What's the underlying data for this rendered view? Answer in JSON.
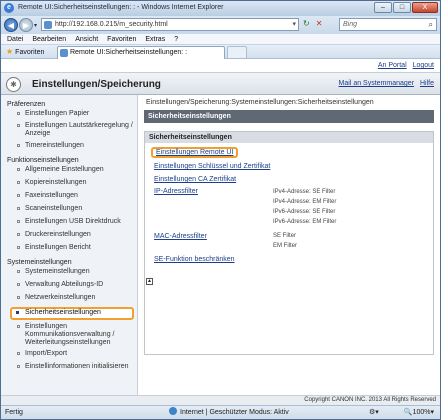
{
  "window": {
    "title": "Remote UI:Sicherheitseinstellungen: :  - Windows Internet Explorer",
    "minimize": "–",
    "maximize": "□",
    "close": "X"
  },
  "address": {
    "url": "http://192.168.0.215/m_security.html",
    "search_placeholder": "Bing",
    "back": "◀",
    "forward": "▶"
  },
  "menu": [
    "Datei",
    "Bearbeiten",
    "Ansicht",
    "Favoriten",
    "Extras",
    "?"
  ],
  "favorites": {
    "label": "Favoriten",
    "tab_title": "Remote UI:Sicherheitseinstellungen: :"
  },
  "portal": {
    "links": [
      "An Portal",
      "Logout"
    ]
  },
  "header": {
    "title": "Einstellungen/Speicherung",
    "links": [
      "Mail an Systemmanager",
      "Hilfe"
    ]
  },
  "sidebar": {
    "sections": [
      {
        "title": "Präferenzen",
        "items": [
          {
            "label": "Einstellungen Papier"
          },
          {
            "label": "Einstellungen Lautstärkeregelung / Anzeige"
          },
          {
            "label": "Timereinstellungen"
          }
        ]
      },
      {
        "title": "Funktionseinstellungen",
        "items": [
          {
            "label": "Allgemeine Einstellungen"
          },
          {
            "label": "Kopiereinstellungen"
          },
          {
            "label": "Faxeinstellungen"
          },
          {
            "label": "Scaneinstellungen"
          },
          {
            "label": "Einstellungen USB Direktdruck"
          },
          {
            "label": "Druckereinstellungen"
          },
          {
            "label": "Einstellungen Bericht"
          }
        ]
      },
      {
        "title": "Systemeinstellungen",
        "items": [
          {
            "label": "Systemeinstellungen"
          },
          {
            "label": "Verwaltung Abteilungs-ID"
          },
          {
            "label": "Netzwerkeinstellungen"
          },
          {
            "label": "Sicherheitseinstellungen",
            "selected": true
          },
          {
            "label": "Einstellungen Kommunikationsverwaltung / Weiterleitungseinstellungen"
          },
          {
            "label": "Import/Export"
          },
          {
            "label": "Einstellinformationen initialisieren"
          }
        ]
      }
    ]
  },
  "main": {
    "breadcrumb": "Einstellungen/Speicherung:Systemeinstellungen:Sicherheitseinstellungen",
    "title": "Sicherheitseinstellungen",
    "panel_title": "Sicherheitseinstellungen",
    "links": [
      "Einstellungen Remote UI",
      "Einstellungen Schlüssel und Zertifikat",
      "Einstellungen CA Zertifikat",
      "IP-Adressfilter",
      "MAC-Adressfilter",
      "SE-Funktion beschränken"
    ],
    "ip_filters": [
      "IPv4-Adresse: SE Filter",
      "IPv4-Adresse: EM Filter",
      "IPv6-Adresse: SE Filter",
      "IPv6-Adresse: EM Filter"
    ],
    "mac_filters": [
      "SE Filter",
      "EM Filter"
    ],
    "top_icon": "▲"
  },
  "footer": "Copyright CANON INC. 2013 All Rights Reserved",
  "status": {
    "text": "Fertig",
    "zone": "Internet | Geschützter Modus: Aktiv",
    "zoom": "100%"
  }
}
